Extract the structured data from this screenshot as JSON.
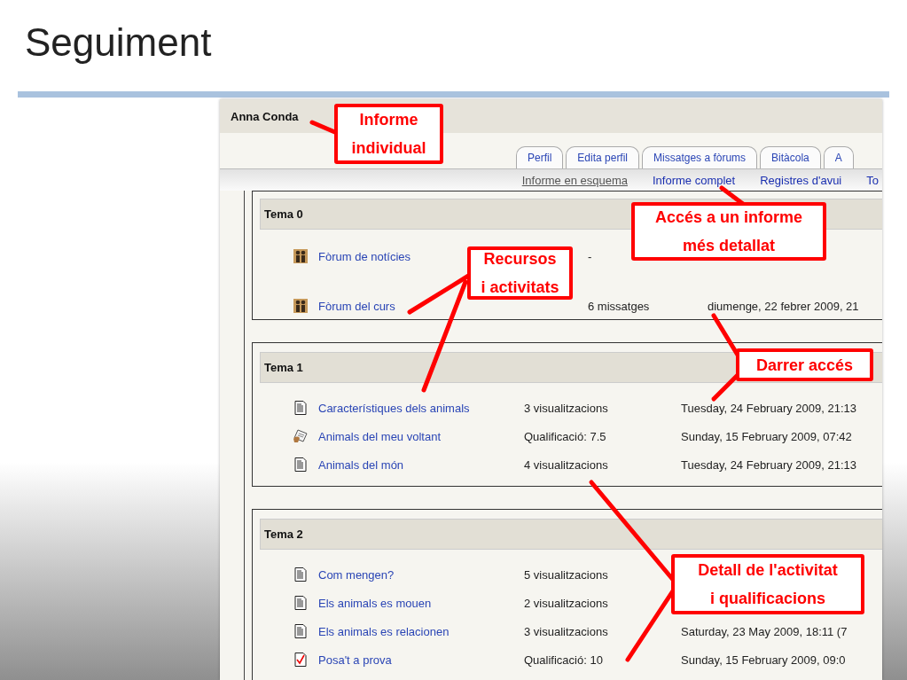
{
  "slide": {
    "title": "Seguiment"
  },
  "screenshot": {
    "user_name": "Anna Conda",
    "tabs": [
      {
        "label": "Perfil"
      },
      {
        "label": "Edita perfil"
      },
      {
        "label": "Missatges a fòrums"
      },
      {
        "label": "Bitàcola"
      },
      {
        "label": "A"
      }
    ],
    "report_links": [
      {
        "label": "Informe en esquema",
        "selected": true
      },
      {
        "label": "Informe complet",
        "selected": false
      },
      {
        "label": "Registres d'avui",
        "selected": false
      },
      {
        "label": "To",
        "selected": false
      }
    ],
    "sections": [
      {
        "title": "Tema 0",
        "items": [
          {
            "kind": "forum",
            "name": "Fòrum de notícies",
            "count": "-"
          },
          {
            "kind": "forum",
            "name": "Fòrum del curs",
            "count": "6 missatges",
            "date": "diumenge, 22 febrer 2009, 21"
          }
        ]
      },
      {
        "title": "Tema 1",
        "items": [
          {
            "kind": "page",
            "name": "Característiques dels animals",
            "count": "3 visualitzacions",
            "date": "Tuesday, 24 February 2009, 21:13"
          },
          {
            "kind": "assignment",
            "name": "Animals del meu voltant",
            "count": "Qualificació: 7.5",
            "date": "Sunday, 15 February 2009, 07:42"
          },
          {
            "kind": "page",
            "name": "Animals del món",
            "count": "4 visualitzacions",
            "date": "Tuesday, 24 February 2009, 21:13"
          }
        ]
      },
      {
        "title": "Tema 2",
        "items": [
          {
            "kind": "page",
            "name": "Com mengen?",
            "count": "5 visualitzacions"
          },
          {
            "kind": "page",
            "name": "Els animals es mouen",
            "count": "2 visualitzacions"
          },
          {
            "kind": "page",
            "name": "Els animals es relacionen",
            "count": "3 visualitzacions",
            "date": "Saturday, 23 May 2009, 18:11 (7"
          },
          {
            "kind": "quiz",
            "name": "Posa't a prova",
            "count": "Qualificació: 10",
            "date": "Sunday, 15 February 2009, 09:0"
          }
        ]
      }
    ]
  },
  "callouts": [
    {
      "lines": [
        "Informe",
        "individual"
      ]
    },
    {
      "lines": [
        "Accés a un informe",
        "més detallat"
      ]
    },
    {
      "lines": [
        "Recursos",
        "i activitats"
      ]
    },
    {
      "lines": [
        "Darrer accés"
      ]
    },
    {
      "lines": [
        "Detall de l'activitat",
        "i qualificacions"
      ]
    }
  ]
}
